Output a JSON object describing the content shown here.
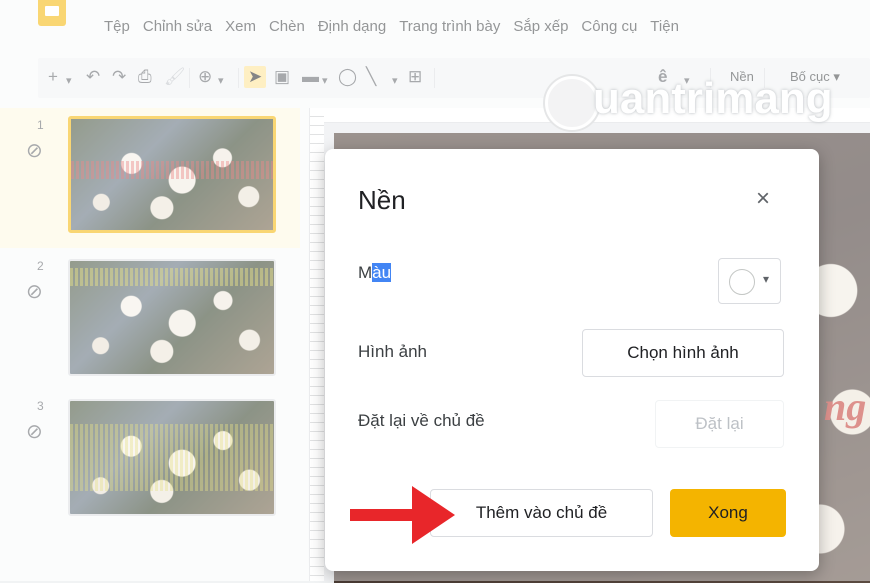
{
  "menu": {
    "items": [
      "Tệp",
      "Chỉnh sửa",
      "Xem",
      "Chèn",
      "Định dạng",
      "Trang trình bày",
      "Sắp xếp",
      "Công cụ",
      "Tiện"
    ]
  },
  "toolbar": {
    "background_label": "Nền",
    "layout_label": "Bố cục ▾"
  },
  "watermark": {
    "text": "uantrimang"
  },
  "slides": [
    {
      "number": "1"
    },
    {
      "number": "2"
    },
    {
      "number": "3"
    }
  ],
  "canvas": {
    "partial_word": "ng"
  },
  "dialog": {
    "title": "Nền",
    "close_glyph": "×",
    "color": {
      "label_prefix": "M",
      "label_selected": "àu"
    },
    "image": {
      "label": "Hình ảnh",
      "button": "Chọn hình ảnh"
    },
    "reset": {
      "label": "Đặt lại về chủ đề",
      "button": "Đặt lại"
    },
    "add_to_theme_button": "Thêm vào chủ đề",
    "done_button": "Xong"
  },
  "colors": {
    "accent_yellow": "#f4b400",
    "selection_blue": "#4285f4",
    "arrow_red": "#e8262a"
  }
}
